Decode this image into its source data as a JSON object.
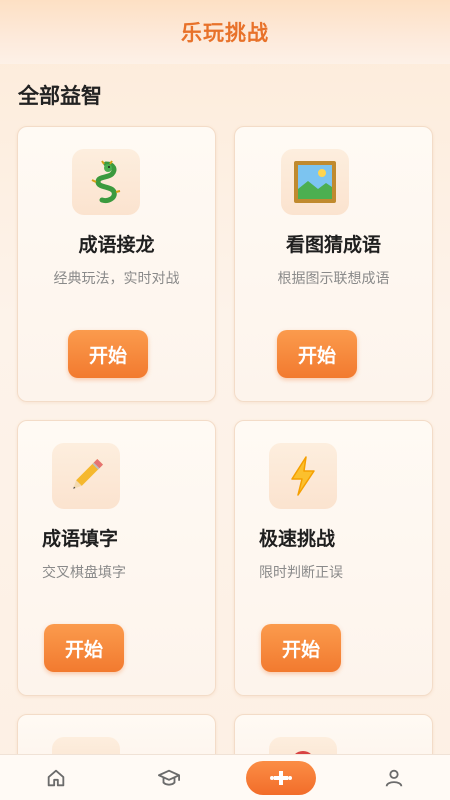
{
  "header": {
    "title": "乐玩挑战"
  },
  "section": {
    "title": "全部益智"
  },
  "games": [
    {
      "title": "成语接龙",
      "desc": "经典玩法，实时对战",
      "button": "开始",
      "icon": "dragon-icon"
    },
    {
      "title": "看图猜成语",
      "desc": "根据图示联想成语",
      "button": "开始",
      "icon": "framed-picture-icon"
    },
    {
      "title": "成语填字",
      "desc": "交叉棋盘填字",
      "button": "开始",
      "icon": "pencil-icon"
    },
    {
      "title": "极速挑战",
      "desc": "限时判断正误",
      "button": "开始",
      "icon": "lightning-icon"
    }
  ],
  "nav": {
    "items": [
      "home-icon",
      "graduation-cap-icon",
      "gamepad-icon",
      "profile-icon"
    ],
    "active_index": 2
  },
  "colors": {
    "accent": "#f27a2f",
    "title": "#e8722a"
  }
}
